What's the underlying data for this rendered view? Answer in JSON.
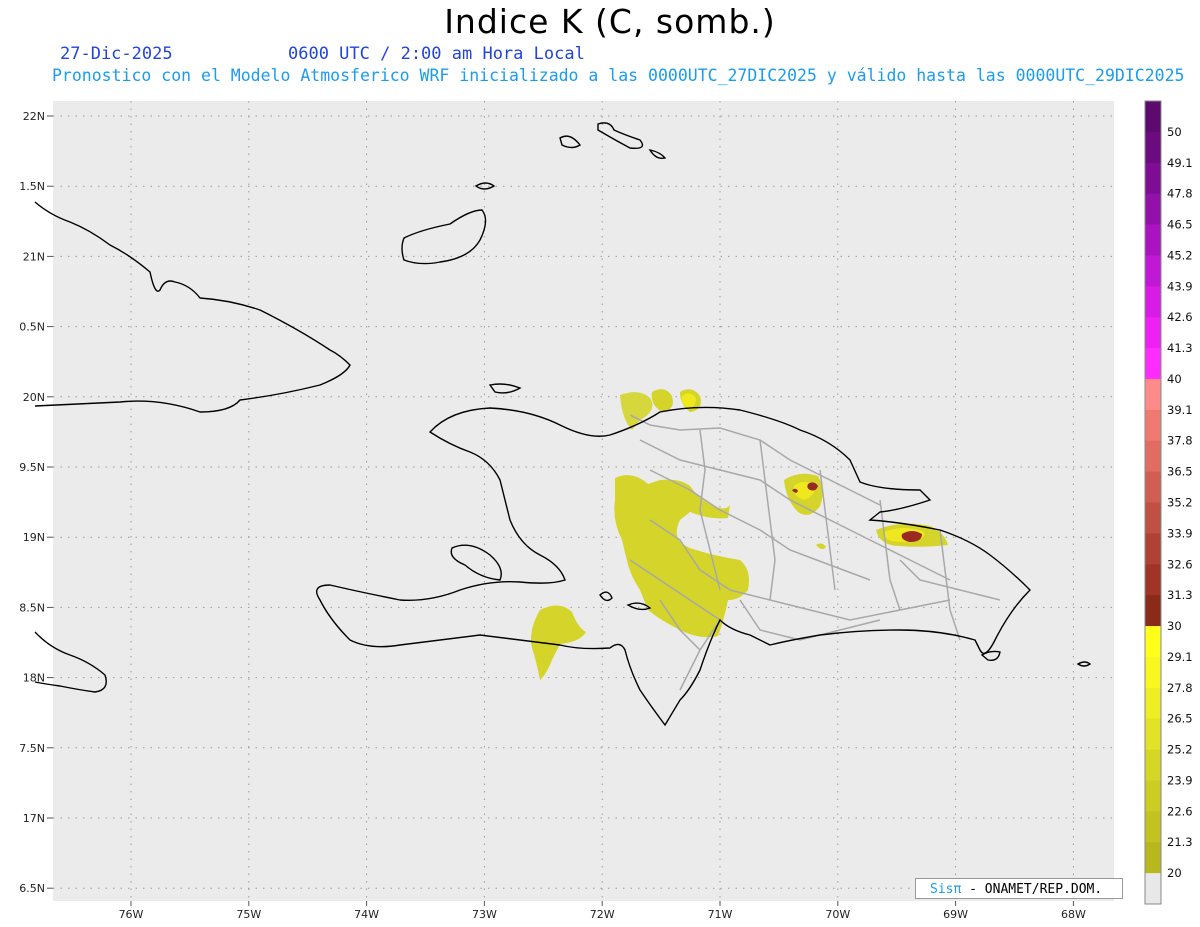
{
  "title": "Indice K (C, somb.)",
  "date": "27-Dic-2025",
  "time_line": "0600 UTC / 2:00 am Hora Local",
  "subtitle": "Pronostico con el Modelo Atmosferico WRF inicializado a las 0000UTC_27DIC2025 y válido hasta las  0000UTC_29DIC2025",
  "credit": {
    "brand": "Sisπ",
    "text": " - ONAMET/REP.DOM."
  },
  "axes": {
    "lat_labels": [
      "22N",
      "1.5N",
      "21N",
      "0.5N",
      "20N",
      "9.5N",
      "19N",
      "8.5N",
      "18N",
      "7.5N",
      "17N",
      "6.5N"
    ],
    "lon_labels": [
      "76W",
      "75W",
      "74W",
      "73W",
      "72W",
      "71W",
      "70W",
      "69W",
      "68W"
    ]
  },
  "colorbar": {
    "labels": [
      "50",
      "49.1",
      "47.8",
      "46.5",
      "45.2",
      "43.9",
      "42.6",
      "41.3",
      "40",
      "39.1",
      "37.8",
      "36.5",
      "35.2",
      "33.9",
      "32.6",
      "31.3",
      "30",
      "29.1",
      "27.8",
      "26.5",
      "25.2",
      "23.9",
      "22.6",
      "21.3",
      "20"
    ],
    "colors": [
      "#5c0a6e",
      "#6c0a80",
      "#7e0c94",
      "#9410aa",
      "#aa14c0",
      "#c018d4",
      "#d81ce6",
      "#ee20f4",
      "#ff2cff",
      "#ff8a8a",
      "#f07a72",
      "#e06c62",
      "#d05e52",
      "#c05042",
      "#b04234",
      "#a03426",
      "#8a2a18",
      "#ffff1a",
      "#f8f820",
      "#eeee24",
      "#e2e226",
      "#d6d624",
      "#cccc22",
      "#c2c220",
      "#b8b81e",
      "#e8e8e8"
    ],
    "units": "C"
  },
  "map": {
    "background": "#ebebeb",
    "coast_color": "#000000",
    "province_color": "#a8a8a8",
    "shade_low": "#d4d42a",
    "shade_mid": "#f0e81e",
    "shade_high": "#9a2a20"
  }
}
